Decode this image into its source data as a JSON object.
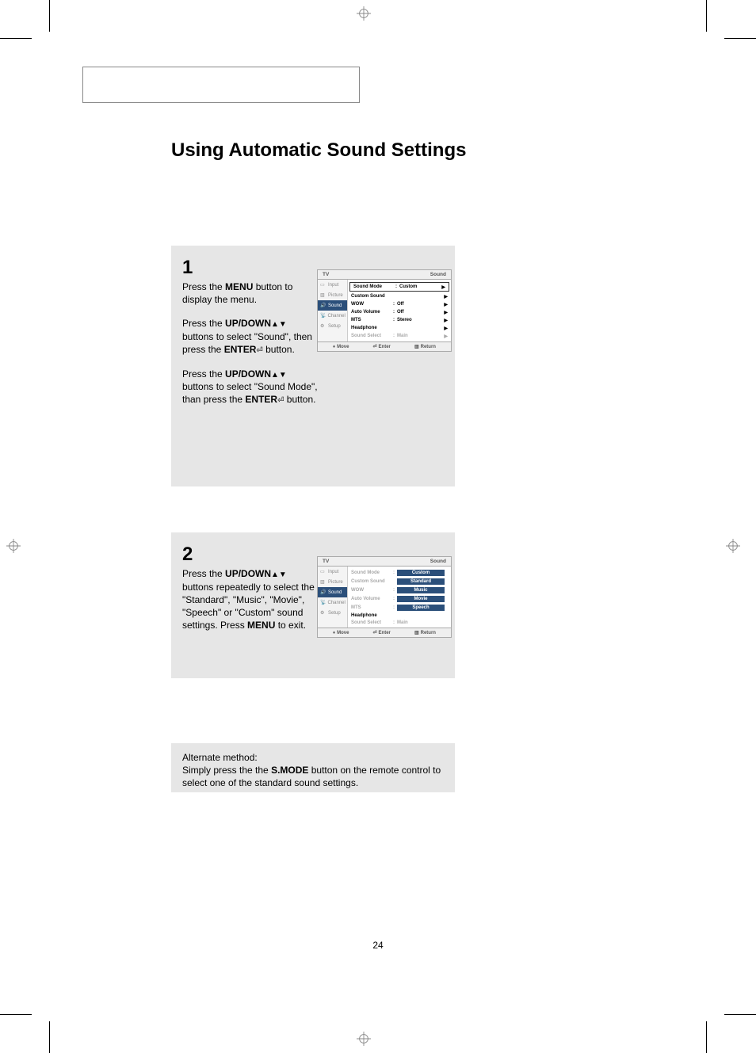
{
  "title": "Using Automatic Sound Settings",
  "page_number": "24",
  "step1": {
    "num": "1",
    "p1a": "Press the ",
    "p1b": "MENU",
    "p1c": " button to display the menu.",
    "p2a": "Press the ",
    "p2b": "UP/DOWN",
    "p2c": " buttons to select \"Sound\", then press the ",
    "p2d": "ENTER",
    "p2e": " button.",
    "p3a": "Press the ",
    "p3b": "UP/DOWN",
    "p3c": " buttons to select \"Sound Mode\", than press the ",
    "p3d": "ENTER",
    "p3e": " button."
  },
  "step2": {
    "num": "2",
    "p1a": "Press the ",
    "p1b": "UP/DOWN",
    "p1c": " buttons repeatedly to select the \"Standard\", \"Music\", \"Movie\", \"Speech\"  or \"Custom\" sound settings. Press ",
    "p1d": "MENU",
    "p1e": " to exit."
  },
  "alt": {
    "line1": "Alternate method:",
    "line2a": "Simply press the the ",
    "line2b": "S.MODE",
    "line2c": " button on the remote control to select one of the standard sound settings."
  },
  "osd": {
    "head_left": "TV",
    "head_right": "Sound",
    "side": [
      "Input",
      "Picture",
      "Sound",
      "Channel",
      "Setup"
    ],
    "rows1": [
      {
        "label": "Sound Mode",
        "value": "Custom",
        "boxed": true
      },
      {
        "label": "Custom Sound",
        "value": ""
      },
      {
        "label": "WOW",
        "value": "Off"
      },
      {
        "label": "Auto Volume",
        "value": "Off"
      },
      {
        "label": "MTS",
        "value": "Stereo"
      },
      {
        "label": "Headphone",
        "value": ""
      },
      {
        "label": "Sound Select",
        "value": "Main",
        "dim": true
      }
    ],
    "rows2": [
      {
        "label": "Sound Mode",
        "pill": "Custom",
        "dim": true
      },
      {
        "label": "Custom Sound",
        "pill": "Standard",
        "dim": true
      },
      {
        "label": "WOW",
        "pill": "Music",
        "dim": true
      },
      {
        "label": "Auto Volume",
        "pill": "Movie",
        "dim": true
      },
      {
        "label": "MTS",
        "pill": "Speech",
        "dim": true
      },
      {
        "label": "Headphone",
        "value": "",
        "dim": false
      },
      {
        "label": "Sound Select",
        "value": "Main",
        "dim": true
      }
    ],
    "foot": {
      "move": "Move",
      "enter": "Enter",
      "return": "Return"
    }
  }
}
